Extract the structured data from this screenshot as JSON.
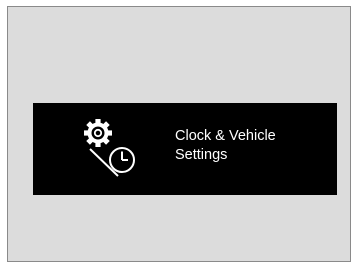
{
  "screen": {
    "background_color": "#dcdcdc",
    "frame_border_color": "#8a8a8a"
  },
  "menu_tile": {
    "label_line1": "Clock & Vehicle",
    "label_line2": "Settings",
    "icon": "gear-clock-icon",
    "background_color": "#000000",
    "text_color": "#ffffff"
  }
}
